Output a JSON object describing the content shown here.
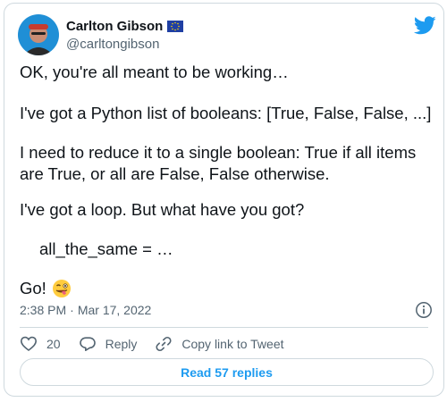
{
  "tweet": {
    "author_name": "Carlton Gibson",
    "author_handle": "@carltongibson",
    "lines": [
      "OK, you're all meant to be working…",
      "I've got a Python list of booleans: [True, False, False, ...]",
      "I need to reduce it to a single boolean: True if all items are True, or all are False, False otherwise.",
      "I've got a loop. But what have you got?",
      "all_the_same = …",
      "Go!"
    ],
    "time": "2:38 PM",
    "separator": "·",
    "date": "Mar 17, 2022"
  },
  "actions": {
    "like_count": "20",
    "reply_label": "Reply",
    "copy_label": "Copy link to Tweet"
  },
  "read_replies_label": "Read 57 replies",
  "icons": {
    "brand": "twitter-bird-icon",
    "flag": "eu-flag-icon",
    "emoji": "winking-face-with-tongue-emoji",
    "info": "info-icon",
    "like": "heart-icon",
    "reply": "reply-bubble-icon",
    "copy": "link-icon"
  },
  "colors": {
    "accent": "#1d9bf0",
    "text": "#0f1419",
    "secondary": "#536471",
    "border": "#cfd9de"
  }
}
